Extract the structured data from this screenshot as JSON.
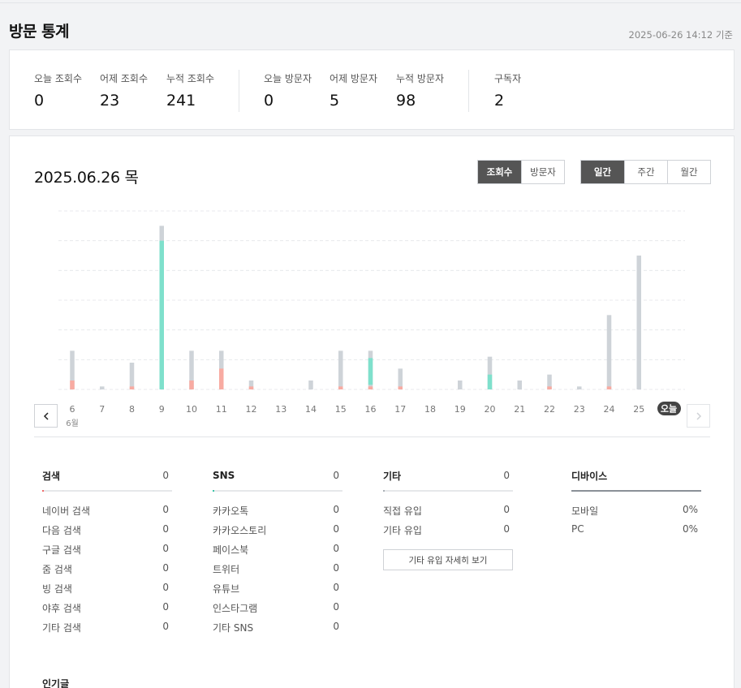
{
  "header": {
    "title": "방문 통계",
    "base_time": "2025-06-26 14:12 기준"
  },
  "stats": [
    {
      "label": "오늘 조회수",
      "value": "0"
    },
    {
      "label": "어제 조회수",
      "value": "23"
    },
    {
      "label": "누적 조회수",
      "value": "241"
    },
    {
      "label": "오늘 방문자",
      "value": "0"
    },
    {
      "label": "어제 방문자",
      "value": "5"
    },
    {
      "label": "누적 방문자",
      "value": "98"
    },
    {
      "label": "구독자",
      "value": "2"
    }
  ],
  "main": {
    "date_title": "2025.06.26 목",
    "metric_tabs": [
      {
        "label": "조회수",
        "active": true
      },
      {
        "label": "방문자",
        "active": false
      }
    ],
    "period_tabs": [
      {
        "label": "일간",
        "active": true
      },
      {
        "label": "주간",
        "active": false
      },
      {
        "label": "월간",
        "active": false
      }
    ],
    "prev_icon": "chevron-left-icon",
    "next_icon": "chevron-right-icon"
  },
  "chart_data": {
    "type": "bar",
    "categories": [
      "6",
      "7",
      "8",
      "9",
      "10",
      "11",
      "12",
      "13",
      "14",
      "15",
      "16",
      "17",
      "18",
      "19",
      "20",
      "21",
      "22",
      "23",
      "24",
      "25",
      "오늘"
    ],
    "month_label": "6월",
    "series": [
      {
        "color": "#ced3d8",
        "values": [
          13,
          1,
          9,
          55,
          13,
          13,
          3,
          0,
          3,
          13,
          13,
          7,
          0,
          3,
          11,
          3,
          5,
          1,
          25,
          45,
          0
        ]
      },
      {
        "color": "#7fe0cc",
        "values": [
          0,
          0,
          0,
          50,
          0,
          0,
          0,
          0,
          0,
          0,
          9,
          0,
          0,
          0,
          5,
          0,
          0,
          0,
          0,
          0,
          0
        ]
      },
      {
        "color": "#f8aba2",
        "values": [
          3,
          0,
          1,
          0,
          3,
          7,
          1,
          0,
          0,
          1,
          1,
          1,
          0,
          0,
          0,
          0,
          1,
          0,
          1,
          0,
          0
        ]
      }
    ],
    "ylim": [
      0,
      60
    ],
    "grid": true
  },
  "sections": {
    "search": {
      "title": "검색",
      "total": "0",
      "accent": "#f06a6a",
      "rows": [
        {
          "label": "네이버 검색",
          "value": "0"
        },
        {
          "label": "다음 검색",
          "value": "0"
        },
        {
          "label": "구글 검색",
          "value": "0"
        },
        {
          "label": "줌 검색",
          "value": "0"
        },
        {
          "label": "빙 검색",
          "value": "0"
        },
        {
          "label": "야후 검색",
          "value": "0"
        },
        {
          "label": "기타 검색",
          "value": "0"
        }
      ]
    },
    "sns": {
      "title": "SNS",
      "total": "0",
      "accent": "#3cc5a8",
      "rows": [
        {
          "label": "카카오톡",
          "value": "0"
        },
        {
          "label": "카카오스토리",
          "value": "0"
        },
        {
          "label": "페이스북",
          "value": "0"
        },
        {
          "label": "트위터",
          "value": "0"
        },
        {
          "label": "유튜브",
          "value": "0"
        },
        {
          "label": "인스타그램",
          "value": "0"
        },
        {
          "label": "기타 SNS",
          "value": "0"
        }
      ]
    },
    "etc": {
      "title": "기타",
      "total": "0",
      "accent": "#aab0b6",
      "rows": [
        {
          "label": "직접 유입",
          "value": "0"
        },
        {
          "label": "기타 유입",
          "value": "0"
        }
      ],
      "detail_button": "기타 유입 자세히 보기"
    },
    "device": {
      "title": "디바이스",
      "rows": [
        {
          "label": "모바일",
          "value": "0%"
        },
        {
          "label": "PC",
          "value": "0%"
        }
      ]
    }
  },
  "popular": {
    "title": "인기글"
  }
}
